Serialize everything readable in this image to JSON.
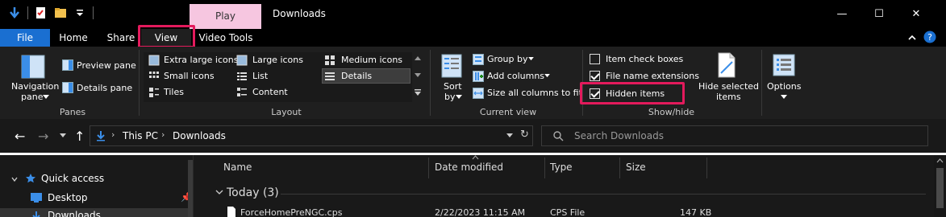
{
  "window": {
    "title": "Downloads",
    "contextual_tab": "Play",
    "controls": {
      "minimize": "—",
      "maximize": "☐",
      "close": "✕"
    }
  },
  "tabs": {
    "file": "File",
    "home": "Home",
    "share": "Share",
    "view": "View",
    "video_tools": "Video Tools"
  },
  "ribbon": {
    "panes": {
      "label": "Panes",
      "navigation_pane": "Navigation pane",
      "navigation_pane_line1": "Navigation",
      "navigation_pane_line2": "pane",
      "preview_pane": "Preview pane",
      "details_pane": "Details pane"
    },
    "layout": {
      "label": "Layout",
      "options": [
        "Extra large icons",
        "Large icons",
        "Medium icons",
        "Small icons",
        "List",
        "Details",
        "Tiles",
        "Content"
      ],
      "selected": "Details"
    },
    "current_view": {
      "label": "Current view",
      "sort_line1": "Sort",
      "sort_line2": "by",
      "group_by": "Group by",
      "add_columns": "Add columns",
      "size_all_columns": "Size all columns to fit"
    },
    "show_hide": {
      "label": "Show/hide",
      "item_check_boxes": "Item check boxes",
      "file_name_extensions": "File name extensions",
      "hidden_items": "Hidden items",
      "checks": {
        "item_check_boxes": false,
        "file_name_extensions": true,
        "hidden_items": true
      },
      "hide_selected_line1": "Hide selected",
      "hide_selected_line2": "items"
    },
    "options": "Options"
  },
  "address": {
    "crumbs": [
      "This PC",
      "Downloads"
    ],
    "search_placeholder": "Search Downloads"
  },
  "nav_pane": {
    "quick_access": "Quick access",
    "desktop": "Desktop",
    "downloads": "Downloads"
  },
  "file_list": {
    "columns": [
      "Name",
      "Date modified",
      "Type",
      "Size"
    ],
    "group": "Today (3)",
    "rows": [
      {
        "name": "ForceHomePreNGC.cps",
        "date": "2/22/2023 11:15 AM",
        "type": "CPS File",
        "size": "147 KB"
      }
    ]
  },
  "colors": {
    "accent_blue": "#1a6fd1",
    "highlight": "#e31a5c",
    "contextual_tab_bg": "#f6c6e0"
  }
}
